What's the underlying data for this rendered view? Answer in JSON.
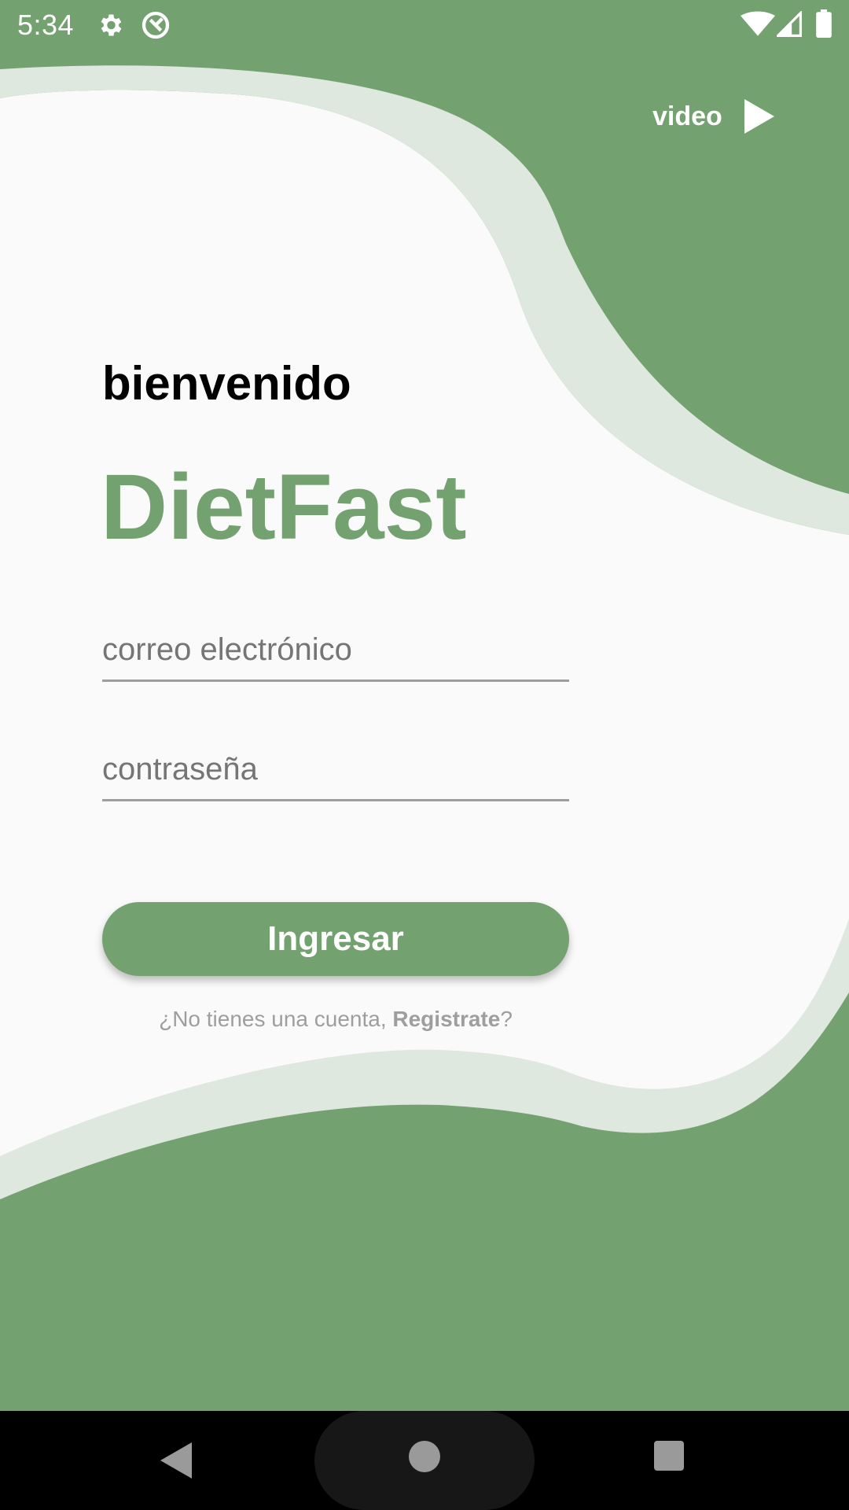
{
  "status_bar": {
    "time": "5:34",
    "icons": [
      "gear-icon",
      "sync-icon",
      "wifi-icon",
      "signal-icon",
      "battery-icon"
    ]
  },
  "header": {
    "video_label": "video",
    "video_icon": "play-icon"
  },
  "welcome": "bienvenido",
  "app_name": "DietFast",
  "form": {
    "email_placeholder": "correo electrónico",
    "password_placeholder": "contraseña",
    "email_value": "",
    "password_value": "",
    "submit_label": "Ingresar"
  },
  "register": {
    "prefix": "¿No tienes una cuenta, ",
    "link": "Registrate",
    "suffix": "?"
  },
  "nav_bar": {
    "icons": [
      "back-icon",
      "home-icon",
      "recents-icon"
    ]
  },
  "colors": {
    "primary": "#73a16f",
    "light_wave": "#dfe8df",
    "background": "#fafafa"
  }
}
